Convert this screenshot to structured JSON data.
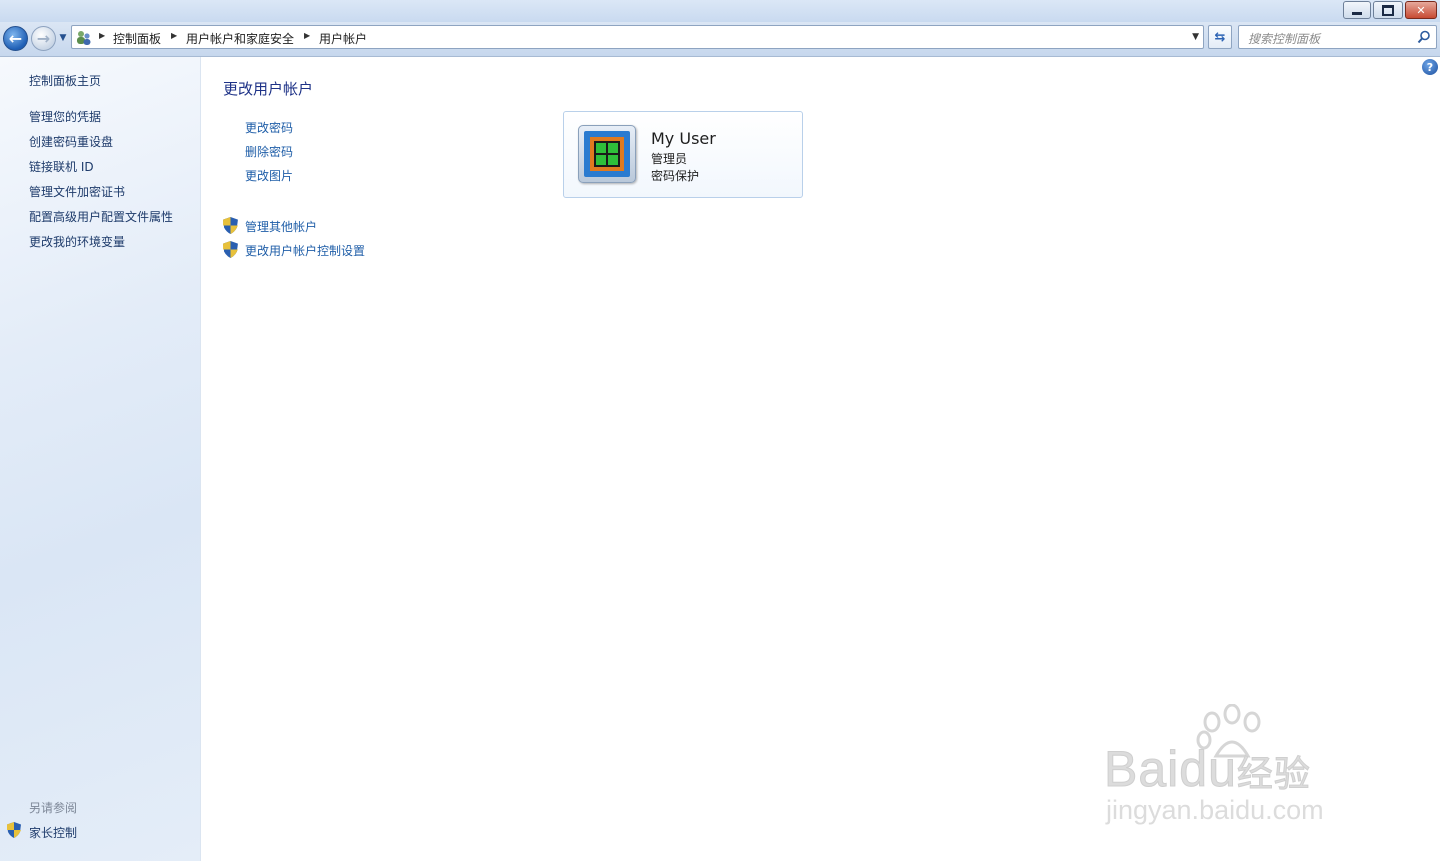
{
  "address_bar": {
    "breadcrumbs": [
      "控制面板",
      "用户帐户和家庭安全",
      "用户帐户"
    ],
    "search_placeholder": "搜索控制面板"
  },
  "left_pane": {
    "home_link": "控制面板主页",
    "tasks": [
      "管理您的凭据",
      "创建密码重设盘",
      "链接联机 ID",
      "管理文件加密证书",
      "配置高级用户配置文件属性",
      "更改我的环境变量"
    ],
    "see_also_heading": "另请参阅",
    "see_also_items": [
      "家长控制"
    ]
  },
  "main": {
    "title": "更改用户帐户",
    "account_tasks": [
      "更改密码",
      "删除密码",
      "更改图片"
    ],
    "admin_tasks": [
      "管理其他帐户",
      "更改用户帐户控制设置"
    ],
    "user": {
      "name": "My User",
      "role": "管理员",
      "status": "密码保护"
    }
  },
  "watermark": {
    "brand_latin": "Bai",
    "brand_du": "du",
    "brand_cn": "经验",
    "url": "jingyan.baidu.com"
  },
  "icons": {
    "back": "back-arrow-icon",
    "forward": "forward-arrow-icon",
    "search": "search-icon",
    "help": "help-icon",
    "shield": "uac-shield-icon"
  },
  "colors": {
    "link": "#1f5ea8",
    "title": "#1e3287",
    "left_link": "#1e3b6b"
  }
}
